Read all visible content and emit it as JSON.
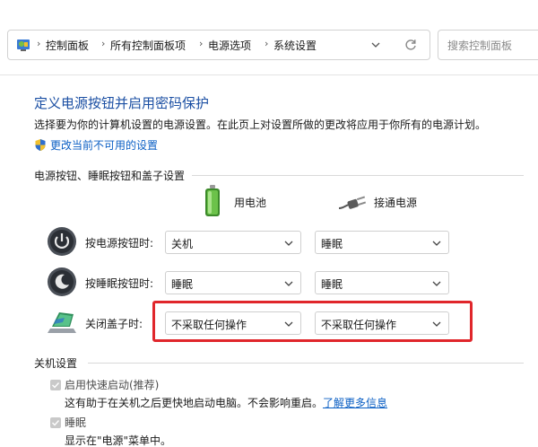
{
  "address": {
    "crumbs": [
      "控制面板",
      "所有控制面板项",
      "电源选项",
      "系统设置"
    ],
    "search_placeholder": "搜索控制面板",
    "icons": [
      "control-panel-icon",
      "chevron-right-icon",
      "chevron-down-icon",
      "refresh-icon"
    ]
  },
  "page": {
    "title": "定义电源按钮并启用密码保护",
    "description": "选择要为你的计算机设置的电源设置。在此页上对设置所做的更改将应用于你所有的电源计划。",
    "change_link": "更改当前不可用的设置"
  },
  "power_group": {
    "label": "电源按钮、睡眠按钮和盖子设置",
    "col_battery": "用电池",
    "col_plugged": "接通电源",
    "rows": [
      {
        "label": "按电源按钮时:",
        "battery": "关机",
        "plugged": "睡眠",
        "icon": "power-button-icon"
      },
      {
        "label": "按睡眠按钮时:",
        "battery": "睡眠",
        "plugged": "睡眠",
        "icon": "sleep-button-icon"
      },
      {
        "label": "关闭盖子时:",
        "battery": "不采取任何操作",
        "plugged": "不采取任何操作",
        "icon": "laptop-lid-icon"
      }
    ]
  },
  "shutdown_group": {
    "label": "关机设置",
    "fast_startup": {
      "label": "启用快速启动(推荐)",
      "hint": "这有助于在关机之后更快地启动电脑。不会影响重启。",
      "link": "了解更多信息",
      "checked": true
    },
    "sleep": {
      "label": "睡眠",
      "hint": "显示在\"电源\"菜单中。",
      "checked": true
    }
  },
  "colors": {
    "title": "#1b4fa3",
    "link": "#0b5fc4",
    "highlight": "#e0262b"
  }
}
